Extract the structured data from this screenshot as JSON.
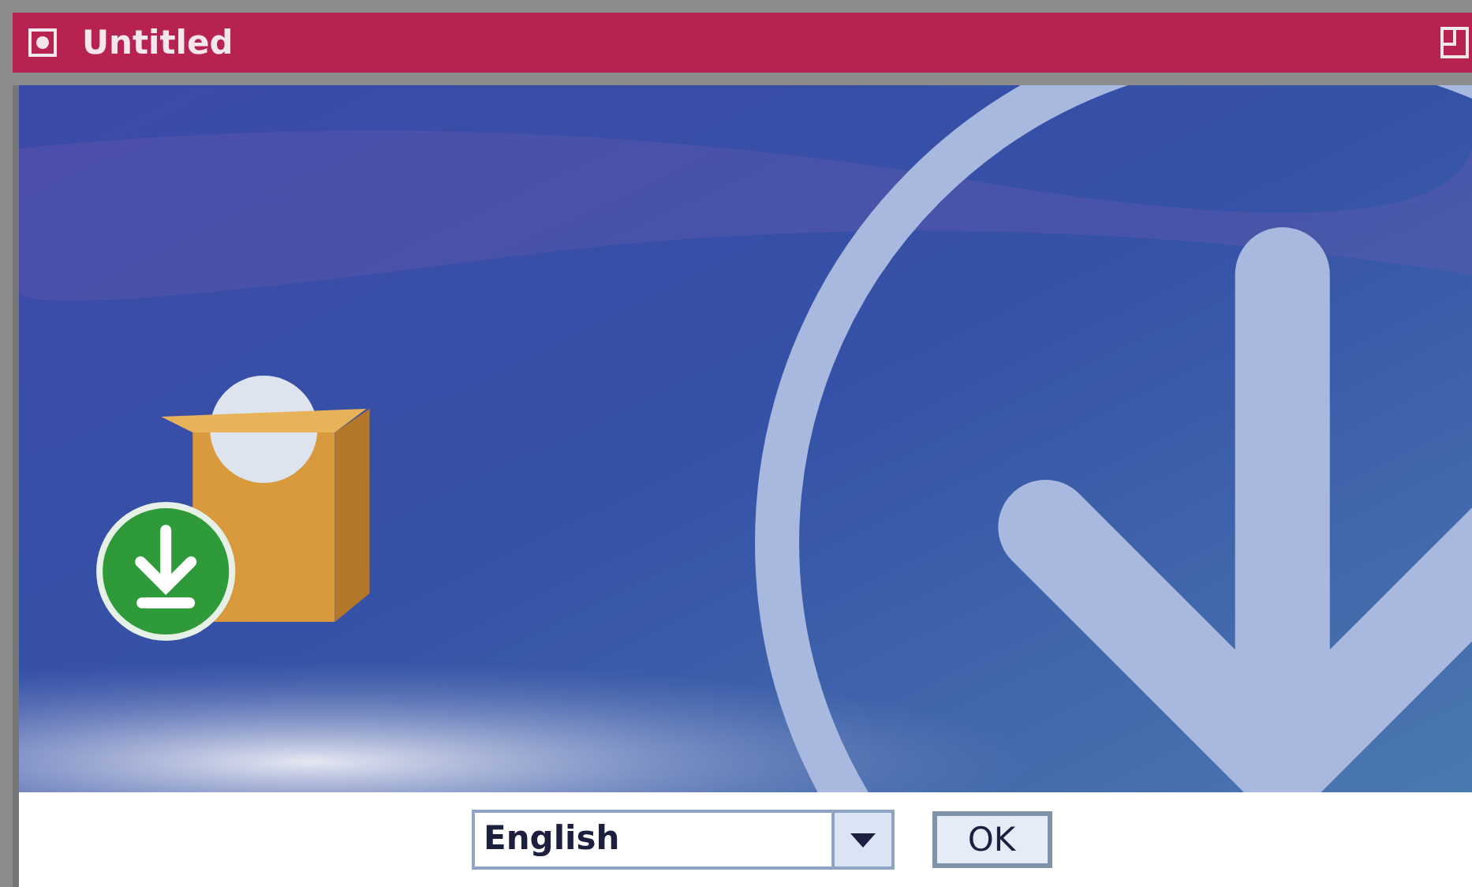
{
  "window": {
    "title": "Untitled"
  },
  "language_select": {
    "value": "English"
  },
  "buttons": [
    "OK"
  ]
}
